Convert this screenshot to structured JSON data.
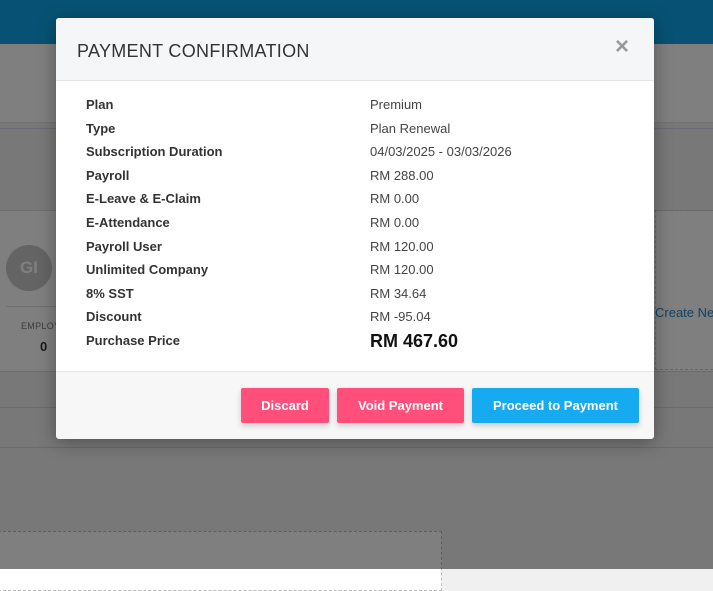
{
  "background": {
    "avatar_initials": "GI",
    "employee_label": "EMPLOY",
    "employee_count": "0",
    "create_link": "Create Ne"
  },
  "modal": {
    "title": "PAYMENT CONFIRMATION",
    "close_icon": "×",
    "rows": [
      {
        "label": "Plan",
        "value": "Premium"
      },
      {
        "label": "Type",
        "value": "Plan Renewal"
      },
      {
        "label": "Subscription Duration",
        "value": "04/03/2025 - 03/03/2026"
      },
      {
        "label": "Payroll",
        "value": "RM 288.00"
      },
      {
        "label": "E-Leave & E-Claim",
        "value": "RM 0.00"
      },
      {
        "label": "E-Attendance",
        "value": "RM 0.00"
      },
      {
        "label": "Payroll User",
        "value": "RM 120.00"
      },
      {
        "label": "Unlimited Company",
        "value": "RM 120.00"
      },
      {
        "label": "8% SST",
        "value": "RM 34.64"
      },
      {
        "label": "Discount",
        "value": "RM -95.04"
      },
      {
        "label": "Purchase Price",
        "value": "RM 467.60"
      }
    ],
    "buttons": {
      "discard": "Discard",
      "void": "Void Payment",
      "proceed": "Proceed to Payment"
    }
  },
  "colors": {
    "topbar": "#0ea5e9",
    "danger": "#ff4f7a",
    "primary": "#16aaf0"
  }
}
